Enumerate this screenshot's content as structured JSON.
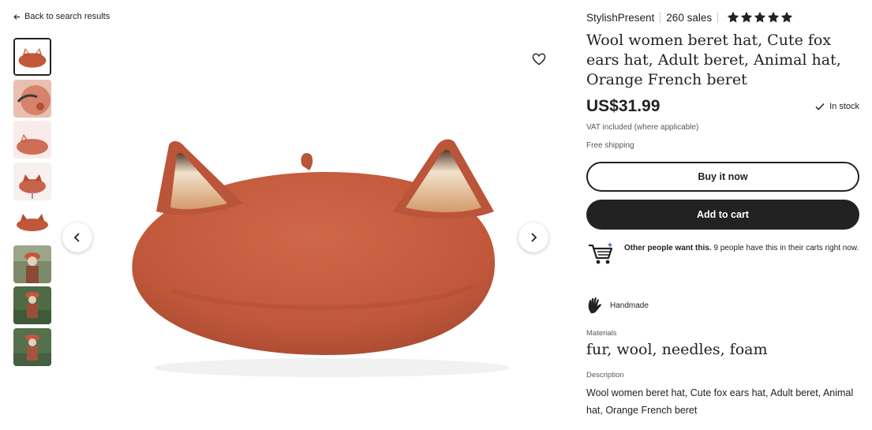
{
  "nav": {
    "back_label": "Back to search results"
  },
  "gallery": {
    "thumbnail_count": 8,
    "selected_index": 0,
    "prev_label": "Previous image",
    "next_label": "Next image",
    "favorite_label": "Add to favorites"
  },
  "listing": {
    "shop_name": "StylishPresent",
    "sales": "260 sales",
    "rating_stars": 5,
    "title": "Wool women beret hat, Cute fox ears hat, Adult beret, Animal hat, Orange French beret",
    "price": "US$31.99",
    "stock_status": "In stock",
    "vat_note": "VAT included (where applicable)",
    "shipping": "Free shipping"
  },
  "actions": {
    "buy_now": "Buy it now",
    "add_to_cart": "Add to cart"
  },
  "social_proof": {
    "bold": "Other people want this.",
    "text": " 9 people have this in their carts right now."
  },
  "details": {
    "handmade": "Handmade",
    "materials_label": "Materials",
    "materials": "fur, wool, needles, foam",
    "description_label": "Description",
    "description": "Wool women beret hat, Cute fox ears hat, Adult beret, Animal hat, Orange French beret"
  },
  "colors": {
    "beret": "#c2583a",
    "text": "#222222",
    "muted": "#595959"
  },
  "icons": [
    "arrow-left-icon",
    "heart-icon",
    "chevron-left-icon",
    "chevron-right-icon",
    "star-icon",
    "check-icon",
    "cart-icon",
    "hand-icon"
  ]
}
